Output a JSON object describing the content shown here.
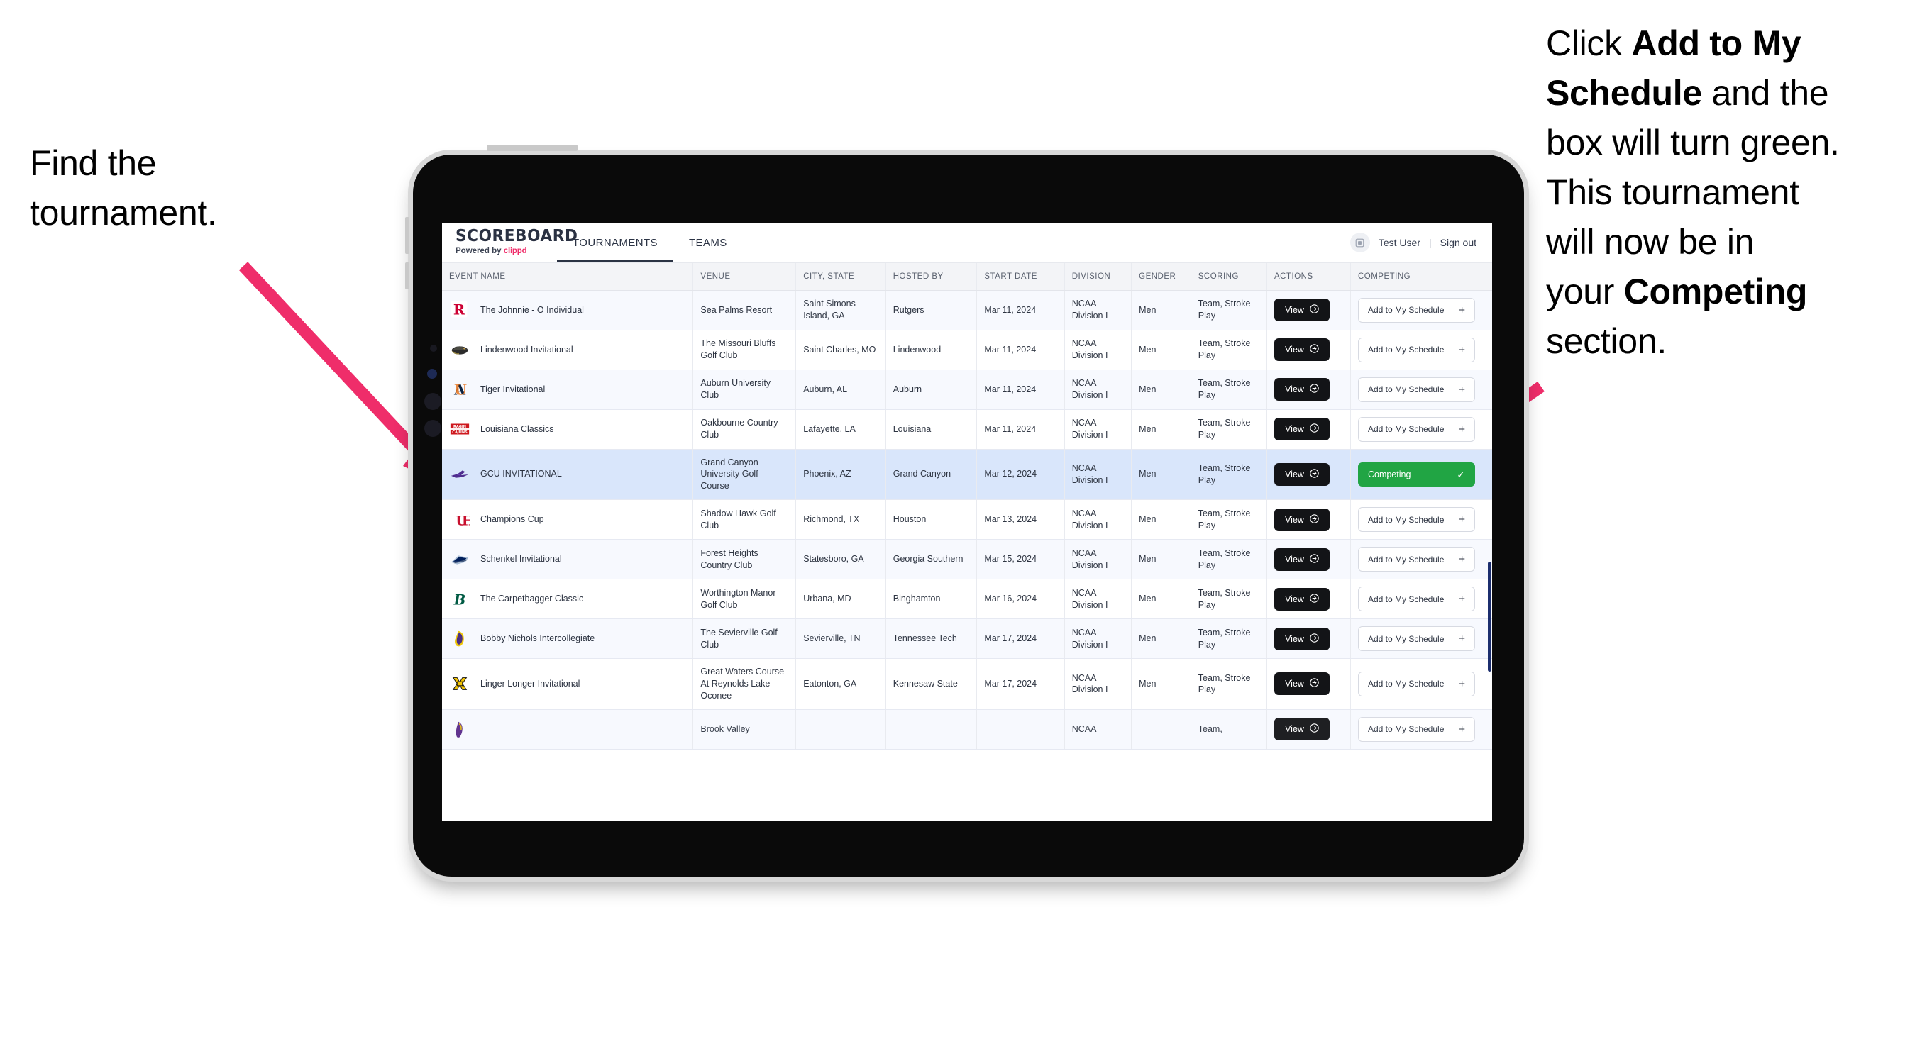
{
  "annotations": {
    "left": [
      "Find the",
      "tournament."
    ],
    "right_lines": [
      [
        {
          "t": "Click ",
          "b": false
        },
        {
          "t": "Add to My",
          "b": true
        }
      ],
      [
        {
          "t": "Schedule",
          "b": true
        },
        {
          "t": " and the",
          "b": false
        }
      ],
      [
        {
          "t": "box will turn green.",
          "b": false
        }
      ],
      [
        {
          "t": "This tournament",
          "b": false
        }
      ],
      [
        {
          "t": "will now be in",
          "b": false
        }
      ],
      [
        {
          "t": "your ",
          "b": false
        },
        {
          "t": "Competing",
          "b": true
        }
      ],
      [
        {
          "t": "section.",
          "b": false
        }
      ]
    ]
  },
  "app": {
    "brand": {
      "title": "SCOREBOARD",
      "powered_prefix": "Powered by ",
      "powered_brand": "clippd"
    },
    "tabs": [
      {
        "label": "TOURNAMENTS",
        "active": true
      },
      {
        "label": "TEAMS",
        "active": false
      }
    ],
    "header_right": {
      "avatar_icon": "user-avatar-icon",
      "user": "Test User",
      "separator": "|",
      "signout": "Sign out"
    }
  },
  "table": {
    "columns": [
      "EVENT NAME",
      "VENUE",
      "CITY, STATE",
      "HOSTED BY",
      "START DATE",
      "DIVISION",
      "GENDER",
      "SCORING",
      "ACTIONS",
      "COMPETING"
    ],
    "add_label": "Add to My Schedule",
    "add_plus": "+",
    "competing_label": "Competing",
    "competing_check": "✓",
    "view_label": "View",
    "rows": [
      {
        "logo": "rutgers-logo",
        "event": "The Johnnie - O Individual",
        "venue": "Sea Palms Resort",
        "city": "Saint Simons Island, GA",
        "host": "Rutgers",
        "date": "Mar 11, 2024",
        "division": "NCAA Division I",
        "gender": "Men",
        "scoring": "Team, Stroke Play",
        "competing": false,
        "selected": false
      },
      {
        "logo": "lindenwood-logo",
        "event": "Lindenwood Invitational",
        "venue": "The Missouri Bluffs Golf Club",
        "city": "Saint Charles, MO",
        "host": "Lindenwood",
        "date": "Mar 11, 2024",
        "division": "NCAA Division I",
        "gender": "Men",
        "scoring": "Team, Stroke Play",
        "competing": false,
        "selected": false
      },
      {
        "logo": "auburn-logo",
        "event": "Tiger Invitational",
        "venue": "Auburn University Club",
        "city": "Auburn, AL",
        "host": "Auburn",
        "date": "Mar 11, 2024",
        "division": "NCAA Division I",
        "gender": "Men",
        "scoring": "Team, Stroke Play",
        "competing": false,
        "selected": false
      },
      {
        "logo": "louisiana-logo",
        "event": "Louisiana Classics",
        "venue": "Oakbourne Country Club",
        "city": "Lafayette, LA",
        "host": "Louisiana",
        "date": "Mar 11, 2024",
        "division": "NCAA Division I",
        "gender": "Men",
        "scoring": "Team, Stroke Play",
        "competing": false,
        "selected": false
      },
      {
        "logo": "grandcanyon-logo",
        "event": "GCU INVITATIONAL",
        "venue": "Grand Canyon University Golf Course",
        "city": "Phoenix, AZ",
        "host": "Grand Canyon",
        "date": "Mar 12, 2024",
        "division": "NCAA Division I",
        "gender": "Men",
        "scoring": "Team, Stroke Play",
        "competing": true,
        "selected": true
      },
      {
        "logo": "houston-logo",
        "event": "Champions Cup",
        "venue": "Shadow Hawk Golf Club",
        "city": "Richmond, TX",
        "host": "Houston",
        "date": "Mar 13, 2024",
        "division": "NCAA Division I",
        "gender": "Men",
        "scoring": "Team, Stroke Play",
        "competing": false,
        "selected": false
      },
      {
        "logo": "georgiasouthern-logo",
        "event": "Schenkel Invitational",
        "venue": "Forest Heights Country Club",
        "city": "Statesboro, GA",
        "host": "Georgia Southern",
        "date": "Mar 15, 2024",
        "division": "NCAA Division I",
        "gender": "Men",
        "scoring": "Team, Stroke Play",
        "competing": false,
        "selected": false
      },
      {
        "logo": "binghamton-logo",
        "event": "The Carpetbagger Classic",
        "venue": "Worthington Manor Golf Club",
        "city": "Urbana, MD",
        "host": "Binghamton",
        "date": "Mar 16, 2024",
        "division": "NCAA Division I",
        "gender": "Men",
        "scoring": "Team, Stroke Play",
        "competing": false,
        "selected": false
      },
      {
        "logo": "tennesseetech-logo",
        "event": "Bobby Nichols Intercollegiate",
        "venue": "The Sevierville Golf Club",
        "city": "Sevierville, TN",
        "host": "Tennessee Tech",
        "date": "Mar 17, 2024",
        "division": "NCAA Division I",
        "gender": "Men",
        "scoring": "Team, Stroke Play",
        "competing": false,
        "selected": false
      },
      {
        "logo": "kennesawstate-logo",
        "event": "Linger Longer Invitational",
        "venue": "Great Waters Course At Reynolds Lake Oconee",
        "city": "Eatonton, GA",
        "host": "Kennesaw State",
        "date": "Mar 17, 2024",
        "division": "NCAA Division I",
        "gender": "Men",
        "scoring": "Team, Stroke Play",
        "competing": false,
        "selected": false
      },
      {
        "logo": "eastcarolina-logo",
        "event": "",
        "venue": "Brook Valley",
        "city": "",
        "host": "",
        "date": "",
        "division": "NCAA",
        "gender": "",
        "scoring": "Team,",
        "competing": false,
        "selected": false,
        "clipped": true
      }
    ]
  },
  "colors": {
    "accent_pink": "#ef2d6a",
    "competing_green": "#21a544",
    "selected_row": "#d9e6fb",
    "dark_button": "#131417"
  }
}
